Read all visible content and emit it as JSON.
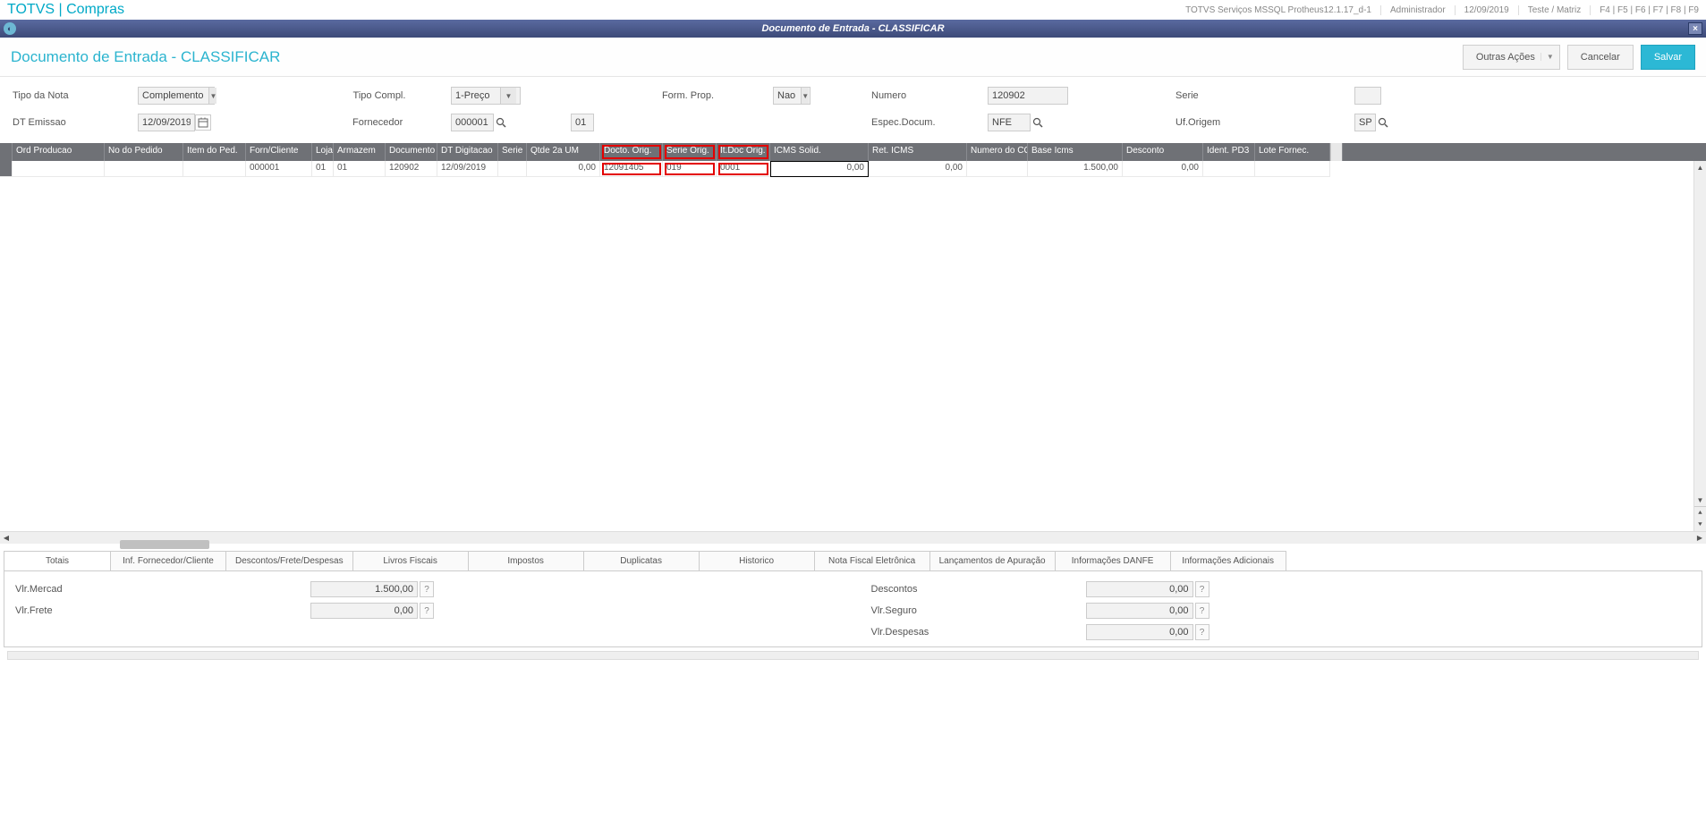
{
  "topbar": {
    "app": "TOTVS | Compras",
    "service": "TOTVS Serviços MSSQL Protheus12.1.17_d-1",
    "user": "Administrador",
    "date": "12/09/2019",
    "env": "Teste / Matriz",
    "fkeys": "F4 | F5 | F6 | F7 | F8 | F9"
  },
  "window": {
    "title": "Documento de Entrada - CLASSIFICAR"
  },
  "header": {
    "page_title": "Documento de Entrada - CLASSIFICAR",
    "outras_acoes": "Outras Ações",
    "cancelar": "Cancelar",
    "salvar": "Salvar"
  },
  "form": {
    "tipo_nota_label": "Tipo da Nota",
    "tipo_nota_value": "Complemento",
    "tipo_compl_label": "Tipo Compl.",
    "tipo_compl_value": "1-Preço",
    "form_prop_label": "Form. Prop.",
    "form_prop_value": "Nao",
    "numero_label": "Numero",
    "numero_value": "120902",
    "serie_label": "Serie",
    "serie_value": "",
    "dt_emissao_label": "DT Emissao",
    "dt_emissao_value": "12/09/2019",
    "fornecedor_label": "Fornecedor",
    "fornecedor_value": "000001",
    "fornecedor_loja": "01",
    "espec_label": "Espec.Docum.",
    "espec_value": "NFE",
    "uf_label": "Uf.Origem",
    "uf_value": "SP"
  },
  "grid": {
    "headers": {
      "ord": "Ord Producao",
      "ped": "No do Pedido",
      "item": "Item do Ped.",
      "forn": "Forn/Cliente",
      "loja": "Loja",
      "arm": "Armazem",
      "doc": "Documento",
      "dt": "DT Digitacao",
      "ser": "Serie",
      "qtde": "Qtde 2a UM",
      "dorig": "Docto. Orig.",
      "sorig": "Serie Orig.",
      "itorig": "It.Doc Orig.",
      "icms": "ICMS Solid.",
      "ret": "Ret. ICMS",
      "cq": "Numero do CQ",
      "base": "Base Icms",
      "desc": "Desconto",
      "pd3": "Ident. PD3",
      "lote": "Lote Fornec."
    },
    "row": {
      "ord": "",
      "ped": "",
      "item": "",
      "forn": "000001",
      "loja": "01",
      "arm": "01",
      "doc": "120902",
      "dt": "12/09/2019",
      "ser": "",
      "qtde": "0,00",
      "dorig": "12091405",
      "sorig": "019",
      "itorig": "0001",
      "icms": "0,00",
      "ret": "0,00",
      "cq": "",
      "base": "1.500,00",
      "desc": "0,00",
      "pd3": "",
      "lote": ""
    }
  },
  "tabs": {
    "totais": "Totais",
    "inf_forn": "Inf. Fornecedor/Cliente",
    "descontos": "Descontos/Frete/Despesas",
    "livros": "Livros Fiscais",
    "impostos": "Impostos",
    "duplicatas": "Duplicatas",
    "historico": "Historico",
    "nfe": "Nota Fiscal Eletrônica",
    "lanc": "Lançamentos de Apuração",
    "danfe": "Informações DANFE",
    "adic": "Informações Adicionais"
  },
  "totals": {
    "vlr_mercad_label": "Vlr.Mercad",
    "vlr_mercad_value": "1.500,00",
    "vlr_frete_label": "Vlr.Frete",
    "vlr_frete_value": "0,00",
    "descontos_label": "Descontos",
    "descontos_value": "0,00",
    "vlr_seguro_label": "Vlr.Seguro",
    "vlr_seguro_value": "0,00",
    "vlr_desp_label": "Vlr.Despesas",
    "vlr_desp_value": "0,00"
  }
}
